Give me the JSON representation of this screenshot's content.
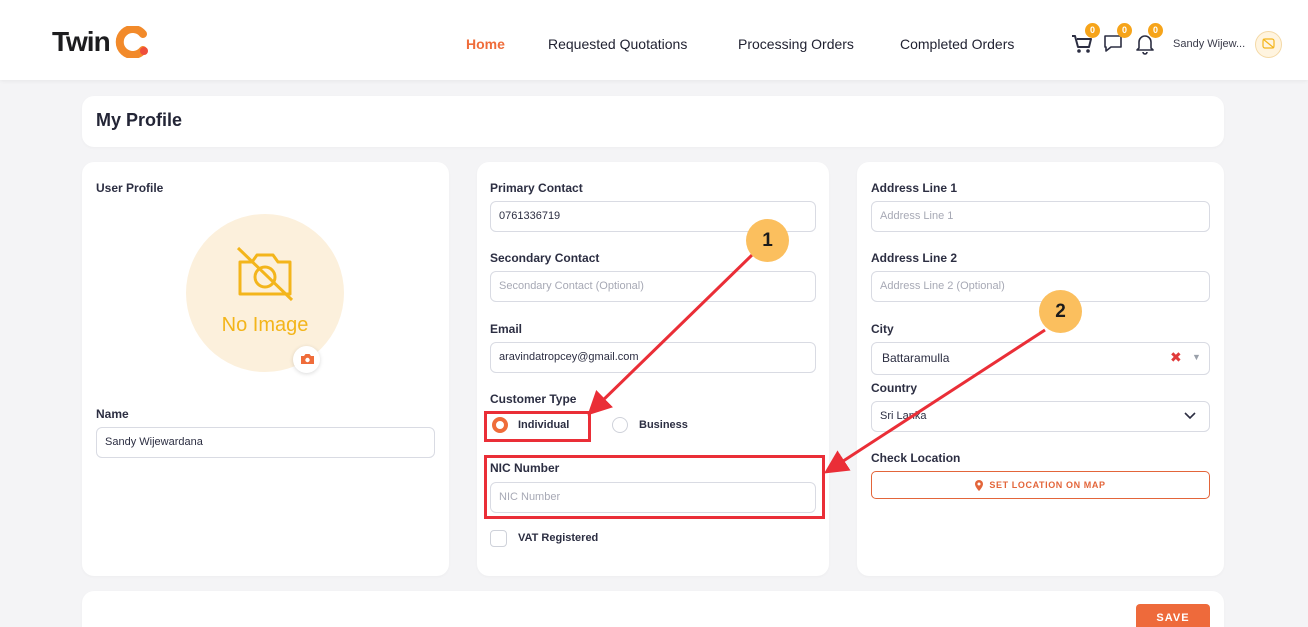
{
  "header": {
    "logo_text": "Twin",
    "nav": [
      "Home",
      "Requested Quotations",
      "Processing Orders",
      "Completed Orders"
    ],
    "badges": {
      "cart": "0",
      "messages": "0",
      "notifications": "0"
    },
    "user_name": "Sandy Wijew..."
  },
  "page": {
    "title": "My Profile"
  },
  "profile": {
    "section_label": "User Profile",
    "no_image_text": "No Image",
    "name_label": "Name",
    "name_value": "Sandy Wijewardana"
  },
  "contact": {
    "primary_label": "Primary Contact",
    "primary_value": "0761336719",
    "secondary_label": "Secondary Contact",
    "secondary_placeholder": "Secondary Contact (Optional)",
    "email_label": "Email",
    "email_value": "aravindatropcey@gmail.com",
    "customer_type_label": "Customer Type",
    "customer_types": [
      "Individual",
      "Business"
    ],
    "nic_label": "NIC Number",
    "nic_placeholder": "NIC Number",
    "vat_label": "VAT Registered"
  },
  "address": {
    "line1_label": "Address Line 1",
    "line1_placeholder": "Address Line 1",
    "line2_label": "Address Line 2",
    "line2_placeholder": "Address Line 2 (Optional)",
    "city_label": "City",
    "city_value": "Battaramulla",
    "country_label": "Country",
    "country_value": "Sri Lanka",
    "check_location_label": "Check Location",
    "set_location_button": "SET LOCATION ON MAP"
  },
  "footer": {
    "save_button": "SAVE"
  },
  "annotations": {
    "step1": "1",
    "step2": "2"
  },
  "colors": {
    "accent": "#ef6c3a",
    "highlight": "#ea2e37",
    "badge": "#f6a41a",
    "step_badge": "#fbbf5e"
  }
}
